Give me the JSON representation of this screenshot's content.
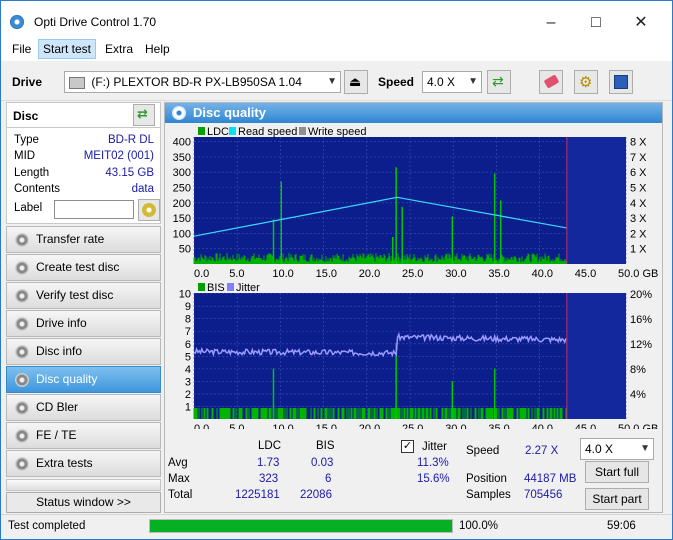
{
  "window": {
    "title": "Opti Drive Control 1.70"
  },
  "menu": [
    "File",
    "Start test",
    "Extra",
    "Help"
  ],
  "toolbar": {
    "drive_label": "Drive",
    "drive_value": "(F:)   PLEXTOR BD-R  PX-LB950SA 1.04",
    "speed_label": "Speed",
    "speed_value": "4.0 X"
  },
  "disc": {
    "header": "Disc",
    "rows": [
      {
        "label": "Type",
        "value": "BD-R DL"
      },
      {
        "label": "MID",
        "value": "MEIT02 (001)"
      },
      {
        "label": "Length",
        "value": "43.15 GB"
      },
      {
        "label": "Contents",
        "value": "data"
      }
    ],
    "label_field": "Label"
  },
  "nav": [
    {
      "label": "Transfer rate",
      "active": false
    },
    {
      "label": "Create test disc",
      "active": false
    },
    {
      "label": "Verify test disc",
      "active": false
    },
    {
      "label": "Drive info",
      "active": false
    },
    {
      "label": "Disc info",
      "active": false
    },
    {
      "label": "Disc quality",
      "active": true
    },
    {
      "label": "CD Bler",
      "active": false
    },
    {
      "label": "FE / TE",
      "active": false
    },
    {
      "label": "Extra tests",
      "active": false
    }
  ],
  "status_window_label": "Status window >>",
  "panel_title": "Disc quality",
  "chart_data": [
    {
      "type": "bar",
      "legend": [
        "LDC",
        "Read speed",
        "Write speed"
      ],
      "legend_colors": [
        "#00a000",
        "#00e0ff",
        "#909090"
      ],
      "x_ticks": [
        "0.0",
        "5.0",
        "10.0",
        "15.0",
        "20.0",
        "25.0",
        "30.0",
        "35.0",
        "40.0",
        "45.0",
        "50.0 GB"
      ],
      "y_left_ticks": [
        "400",
        "350",
        "300",
        "250",
        "200",
        "150",
        "100",
        "50"
      ],
      "y_right_ticks": [
        "8 X",
        "7 X",
        "6 X",
        "5 X",
        "4 X",
        "3 X",
        "2 X",
        "1 X"
      ],
      "xlim": [
        0,
        50
      ],
      "ylim": [
        0,
        400
      ],
      "y2lim": [
        0,
        8
      ],
      "data_end_gb": 43.15,
      "read_speed": {
        "x": [
          0,
          23.5,
          43.15
        ],
        "y": [
          1.75,
          4.2,
          2.27
        ]
      },
      "ldc_spikes": {
        "x": [
          9.2,
          10.1,
          23.0,
          23.4,
          24.1,
          29.9,
          34.8,
          35.5
        ],
        "y": [
          140,
          260,
          85,
          305,
          180,
          150,
          285,
          200
        ]
      }
    },
    {
      "type": "bar",
      "legend": [
        "BIS",
        "Jitter"
      ],
      "legend_colors": [
        "#00a000",
        "#8080ff"
      ],
      "x_ticks": [
        "0.0",
        "5.0",
        "10.0",
        "15.0",
        "20.0",
        "25.0",
        "30.0",
        "35.0",
        "40.0",
        "45.0",
        "50.0 GB"
      ],
      "y_left_ticks": [
        "10",
        "9",
        "8",
        "7",
        "6",
        "5",
        "4",
        "3",
        "2",
        "1"
      ],
      "y_right_ticks": [
        "20%",
        "16%",
        "12%",
        "8%",
        "4%"
      ],
      "xlim": [
        0,
        50
      ],
      "ylim": [
        0,
        10
      ],
      "y2lim": [
        0,
        20
      ],
      "data_end_gb": 43.15,
      "jitter": {
        "x": [
          0,
          23.4,
          23.6,
          43.15
        ],
        "y": [
          10.7,
          10.5,
          13.0,
          12.6
        ]
      },
      "bis_spikes": {
        "x": [
          9.2,
          23.4,
          29.9,
          34.8
        ],
        "y": [
          4,
          6,
          3,
          4
        ]
      }
    }
  ],
  "stats": {
    "col_ldc": "LDC",
    "col_bis": "BIS",
    "jitter_label": "Jitter",
    "jitter_checked": true,
    "rows": [
      {
        "label": "Avg",
        "ldc": "1.73",
        "bis": "0.03",
        "jitter": "11.3%"
      },
      {
        "label": "Max",
        "ldc": "323",
        "bis": "6",
        "jitter": "15.6%"
      },
      {
        "label": "Total",
        "ldc": "1225181",
        "bis": "22086",
        "jitter": ""
      }
    ],
    "speed_label": "Speed",
    "speed_value": "2.27 X",
    "speed_select": "4.0 X",
    "position_label": "Position",
    "position_value": "44187 MB",
    "samples_label": "Samples",
    "samples_value": "705456",
    "start_full": "Start full",
    "start_part": "Start part"
  },
  "statusbar": {
    "text": "Test completed",
    "progress": 100,
    "progress_text": "100.0%",
    "time": "59:06"
  }
}
